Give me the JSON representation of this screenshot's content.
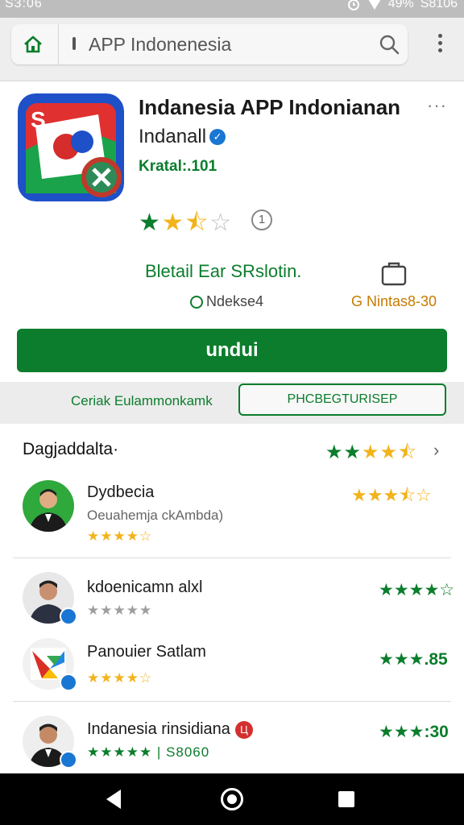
{
  "status_bar": {
    "time": "S3:06",
    "battery": "49%",
    "right_time": "S8106"
  },
  "browser": {
    "url": "APP Indonenesia"
  },
  "app": {
    "title": "Indanesia APP Indonianan",
    "developer": "Indanall",
    "rating_label": "Kratal:.101",
    "stars": "★★⯪☆",
    "info_icon": "①",
    "more_label": "···"
  },
  "details": {
    "title": "Bletail Ear SRslotin.",
    "installs": "Ndekse4",
    "size": "G Nintas8-30"
  },
  "install_button": {
    "label": "undui"
  },
  "tabs": {
    "left": "Ceriak Eulammonkamk",
    "right": "PHCBEGTURISEP"
  },
  "reviews_section": {
    "title": "Dagjaddalta·",
    "stars": "★★★★★",
    "chevron": "›"
  },
  "reviews": [
    {
      "name": "Dydbecia",
      "subtitle": "Oeuahemja ckAmbda)",
      "small_stars": "★★★★☆",
      "right_stars": "★★★⯪☆"
    },
    {
      "name": "kdoenicamn alxl",
      "small_stars": "★★★★★",
      "right_text": "★★★★☆"
    },
    {
      "name": "Panouier Satlam",
      "small_stars": "★★★★☆",
      "right_text": "★★★.85"
    },
    {
      "name": "Indanesia rinsidiana",
      "badge": "Ц",
      "small_stars": "★★★★★ | S8060",
      "right_text": "★★★:30"
    }
  ],
  "colors": {
    "brand_green": "#0b7d2c",
    "star_yellow": "#f2b31b"
  },
  "icons": [
    "home-icon",
    "lock-icon",
    "search-icon",
    "more-vert-icon",
    "verified-icon",
    "info-icon",
    "bag-icon",
    "clock-icon",
    "chevron-right-icon",
    "back-icon",
    "home-nav-icon",
    "recents-icon"
  ]
}
